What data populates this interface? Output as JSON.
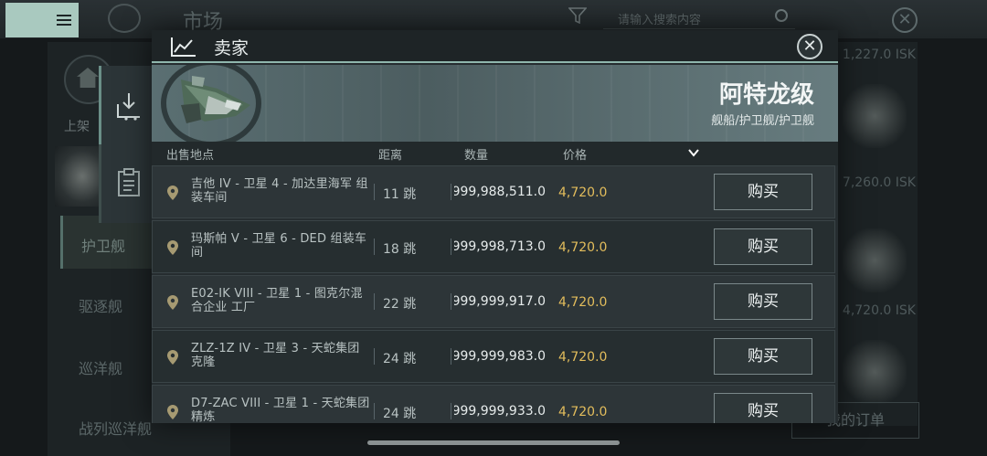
{
  "background": {
    "title": "市场",
    "search_placeholder": "请输入搜索内容",
    "shelf_label": "上架",
    "categories": [
      "护卫舰",
      "驱逐舰",
      "巡洋舰",
      "战列巡洋舰"
    ],
    "right_prices": [
      "1,227.0 ISK",
      "7,260.0 ISK",
      "4,720.0 ISK"
    ],
    "orders_button": "我的订单"
  },
  "modal": {
    "title": "卖家",
    "item": {
      "name": "阿特龙级",
      "category_path": "舰船/护卫舰/护卫舰"
    },
    "columns": {
      "location": "出售地点",
      "distance": "距离",
      "quantity": "数量",
      "price": "价格"
    },
    "rows": [
      {
        "location": "吉他 IV - 卫星 4 - 加达里海军 组装车间",
        "jumps": "11 跳",
        "quantity": "999,988,511.0",
        "price": "4,720.0",
        "button": "购买"
      },
      {
        "location": "玛斯帕 V - 卫星 6 - DED 组装车间",
        "jumps": "18 跳",
        "quantity": "999,998,713.0",
        "price": "4,720.0",
        "button": "购买"
      },
      {
        "location": "E02-IK VIII - 卫星 1 - 图克尔混合企业 工厂",
        "jumps": "22 跳",
        "quantity": "999,999,917.0",
        "price": "4,720.0",
        "button": "购买"
      },
      {
        "location": "ZLZ-1Z IV - 卫星 3 - 天蛇集团 克隆",
        "jumps": "24 跳",
        "quantity": "999,999,983.0",
        "price": "4,720.0",
        "button": "购买"
      },
      {
        "location": "D7-ZAC VIII - 卫星 1 - 天蛇集团 精炼",
        "jumps": "24 跳",
        "quantity": "999,999,933.0",
        "price": "4,720.0",
        "button": "购买"
      }
    ]
  },
  "colors": {
    "accent": "#8fb6ad",
    "price": "#e3bd5c",
    "menu_button": "#a9c9bf"
  }
}
